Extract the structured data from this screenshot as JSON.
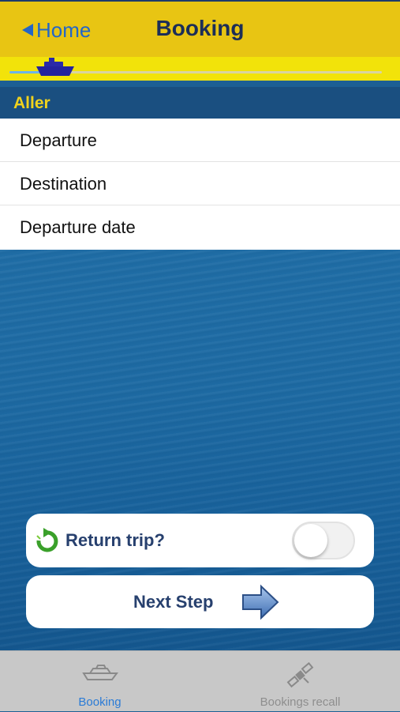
{
  "navbar": {
    "back_label": "Home",
    "title": "Booking"
  },
  "progress": {
    "fraction": 0.15
  },
  "section": {
    "title": "Aller"
  },
  "form": {
    "rows": [
      {
        "label": "Departure"
      },
      {
        "label": "Destination"
      },
      {
        "label": "Departure date"
      }
    ]
  },
  "return_trip": {
    "label": "Return trip?",
    "enabled": false
  },
  "next_step": {
    "label": "Next Step"
  },
  "tabs": [
    {
      "label": "Booking",
      "icon": "ship-icon",
      "active": true
    },
    {
      "label": "Bookings recall",
      "icon": "satellite-icon",
      "active": false
    }
  ],
  "colors": {
    "navbar": "#e8c513",
    "accent_blue": "#2366c7",
    "section_header_text": "#f1d21c",
    "button_text": "#27406e"
  }
}
